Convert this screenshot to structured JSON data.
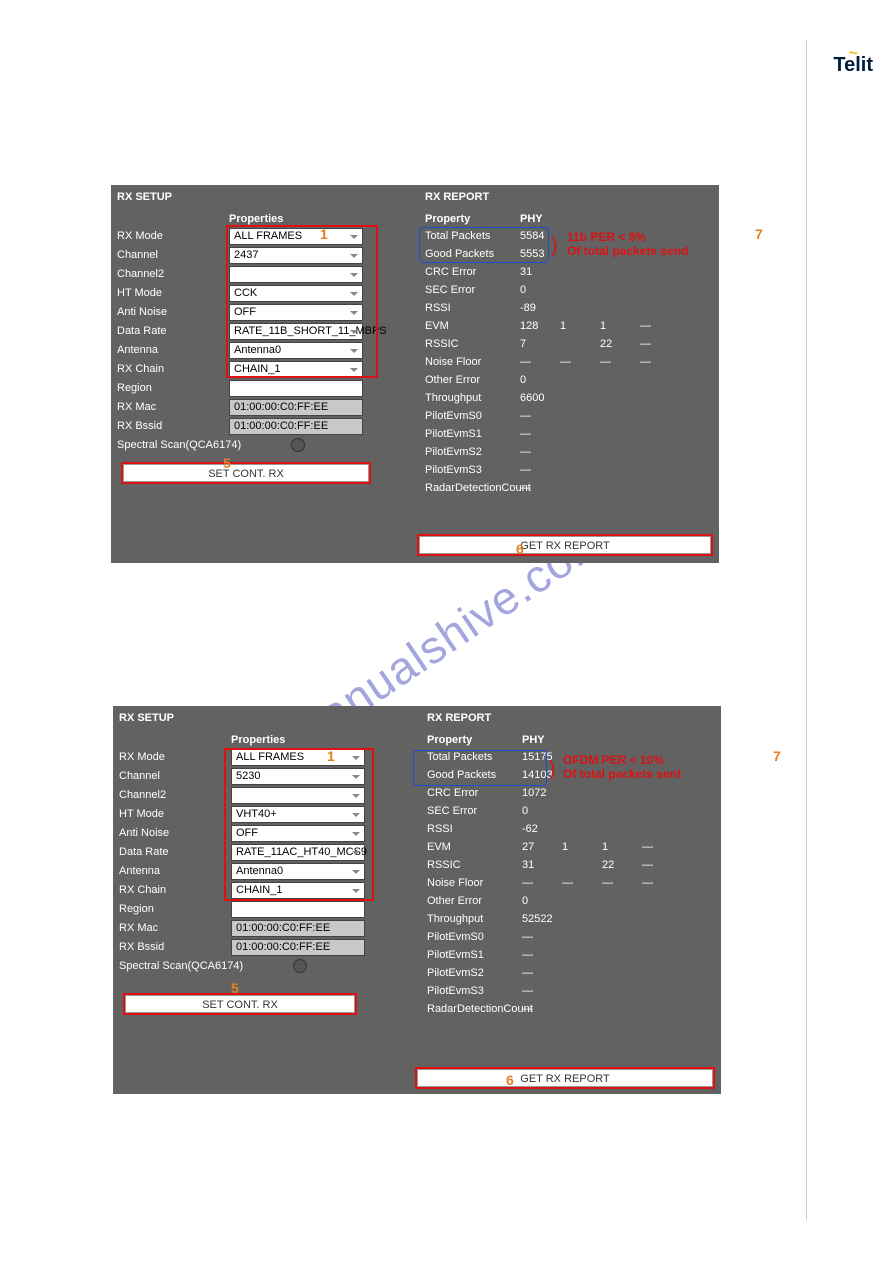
{
  "logo": "Telit",
  "watermark": "manualshive.com",
  "panel1": {
    "setup": {
      "title": "RX SETUP",
      "props_hdr": "Properties",
      "rows": [
        {
          "lbl": "RX Mode",
          "val": "ALL FRAMES",
          "type": "sel"
        },
        {
          "lbl": "Channel",
          "val": "2437",
          "type": "sel"
        },
        {
          "lbl": "Channel2",
          "val": "",
          "type": "sel"
        },
        {
          "lbl": "HT Mode",
          "val": "CCK",
          "type": "sel"
        },
        {
          "lbl": "Anti Noise",
          "val": "OFF",
          "type": "sel"
        },
        {
          "lbl": "Data Rate",
          "val": "RATE_11B_SHORT_11_MBPS",
          "type": "sel"
        },
        {
          "lbl": "Antenna",
          "val": "Antenna0",
          "type": "sel"
        },
        {
          "lbl": "RX Chain",
          "val": "CHAIN_1",
          "type": "sel"
        },
        {
          "lbl": "Region",
          "val": "",
          "type": "sel-noarrow"
        },
        {
          "lbl": "RX Mac",
          "val": "01:00:00:C0:FF:EE",
          "type": "ro"
        },
        {
          "lbl": "RX Bssid",
          "val": "01:00:00:C0:FF:EE",
          "type": "ro"
        },
        {
          "lbl": "Spectral Scan(QCA6174)",
          "val": "",
          "type": "chk"
        }
      ],
      "btn": "SET CONT. RX"
    },
    "report": {
      "title": "RX REPORT",
      "prop_hdr": "Property",
      "phy_hdr": "PHY",
      "rows": [
        {
          "lbl": "Total Packets",
          "v": [
            "5584"
          ]
        },
        {
          "lbl": "Good Packets",
          "v": [
            "5553"
          ]
        },
        {
          "lbl": "CRC Error",
          "v": [
            "31"
          ]
        },
        {
          "lbl": "SEC Error",
          "v": [
            "0"
          ]
        },
        {
          "lbl": "RSSI",
          "v": [
            "-89"
          ]
        },
        {
          "lbl": "EVM",
          "v": [
            "128",
            "1",
            "1",
            "—"
          ]
        },
        {
          "lbl": "RSSIC",
          "v": [
            "7",
            "",
            "22",
            "—"
          ]
        },
        {
          "lbl": "Noise Floor",
          "v": [
            "—",
            "—",
            "—",
            "—"
          ]
        },
        {
          "lbl": "Other Error",
          "v": [
            "0"
          ]
        },
        {
          "lbl": "Throughput",
          "v": [
            "6600"
          ]
        },
        {
          "lbl": "PilotEvmS0",
          "v": [
            "—"
          ]
        },
        {
          "lbl": "PilotEvmS1",
          "v": [
            "—"
          ]
        },
        {
          "lbl": "PilotEvmS2",
          "v": [
            "—"
          ]
        },
        {
          "lbl": "PilotEvmS3",
          "v": [
            "—"
          ]
        },
        {
          "lbl": "RadarDetectionCount",
          "v": [
            "—"
          ]
        }
      ],
      "btn": "GET RX REPORT",
      "annot": {
        "l1": "11b PER < 8%",
        "l2": "Of total packets send",
        "num1": "1",
        "num5": "5",
        "num6": "6",
        "num7": "7"
      }
    }
  },
  "panel2": {
    "setup": {
      "title": "RX SETUP",
      "props_hdr": "Properties",
      "rows": [
        {
          "lbl": "RX Mode",
          "val": "ALL FRAMES",
          "type": "sel"
        },
        {
          "lbl": "Channel",
          "val": "5230",
          "type": "sel"
        },
        {
          "lbl": "Channel2",
          "val": "",
          "type": "sel"
        },
        {
          "lbl": "HT Mode",
          "val": "VHT40+",
          "type": "sel"
        },
        {
          "lbl": "Anti Noise",
          "val": "OFF",
          "type": "sel"
        },
        {
          "lbl": "Data Rate",
          "val": "RATE_11AC_HT40_MCS9",
          "type": "sel"
        },
        {
          "lbl": "Antenna",
          "val": "Antenna0",
          "type": "sel"
        },
        {
          "lbl": "RX Chain",
          "val": "CHAIN_1",
          "type": "sel"
        },
        {
          "lbl": "Region",
          "val": "",
          "type": "sel-noarrow"
        },
        {
          "lbl": "RX Mac",
          "val": "01:00:00:C0:FF:EE",
          "type": "ro"
        },
        {
          "lbl": "RX Bssid",
          "val": "01:00:00:C0:FF:EE",
          "type": "ro"
        },
        {
          "lbl": "Spectral Scan(QCA6174)",
          "val": "",
          "type": "chk"
        }
      ],
      "btn": "SET CONT. RX"
    },
    "report": {
      "title": "RX REPORT",
      "prop_hdr": "Property",
      "phy_hdr": "PHY",
      "rows": [
        {
          "lbl": "Total Packets",
          "v": [
            "15175"
          ]
        },
        {
          "lbl": "Good Packets",
          "v": [
            "14103"
          ]
        },
        {
          "lbl": "CRC Error",
          "v": [
            "1072"
          ]
        },
        {
          "lbl": "SEC Error",
          "v": [
            "0"
          ]
        },
        {
          "lbl": "RSSI",
          "v": [
            "-62"
          ]
        },
        {
          "lbl": "EVM",
          "v": [
            "27",
            "1",
            "1",
            "—"
          ]
        },
        {
          "lbl": "RSSIC",
          "v": [
            "31",
            "",
            "22",
            "—"
          ]
        },
        {
          "lbl": "Noise Floor",
          "v": [
            "—",
            "—",
            "—",
            "—"
          ]
        },
        {
          "lbl": "Other Error",
          "v": [
            "0"
          ]
        },
        {
          "lbl": "Throughput",
          "v": [
            "52522"
          ]
        },
        {
          "lbl": "PilotEvmS0",
          "v": [
            "—"
          ]
        },
        {
          "lbl": "PilotEvmS1",
          "v": [
            "—"
          ]
        },
        {
          "lbl": "PilotEvmS2",
          "v": [
            "—"
          ]
        },
        {
          "lbl": "PilotEvmS3",
          "v": [
            "—"
          ]
        },
        {
          "lbl": "RadarDetectionCount",
          "v": [
            "—"
          ]
        }
      ],
      "btn": "GET RX REPORT",
      "annot": {
        "l1": "OFDM PER < 10%",
        "l2": "Of total packets sent",
        "num1": "1",
        "num5": "5",
        "num6": "6",
        "num7": "7"
      }
    }
  }
}
